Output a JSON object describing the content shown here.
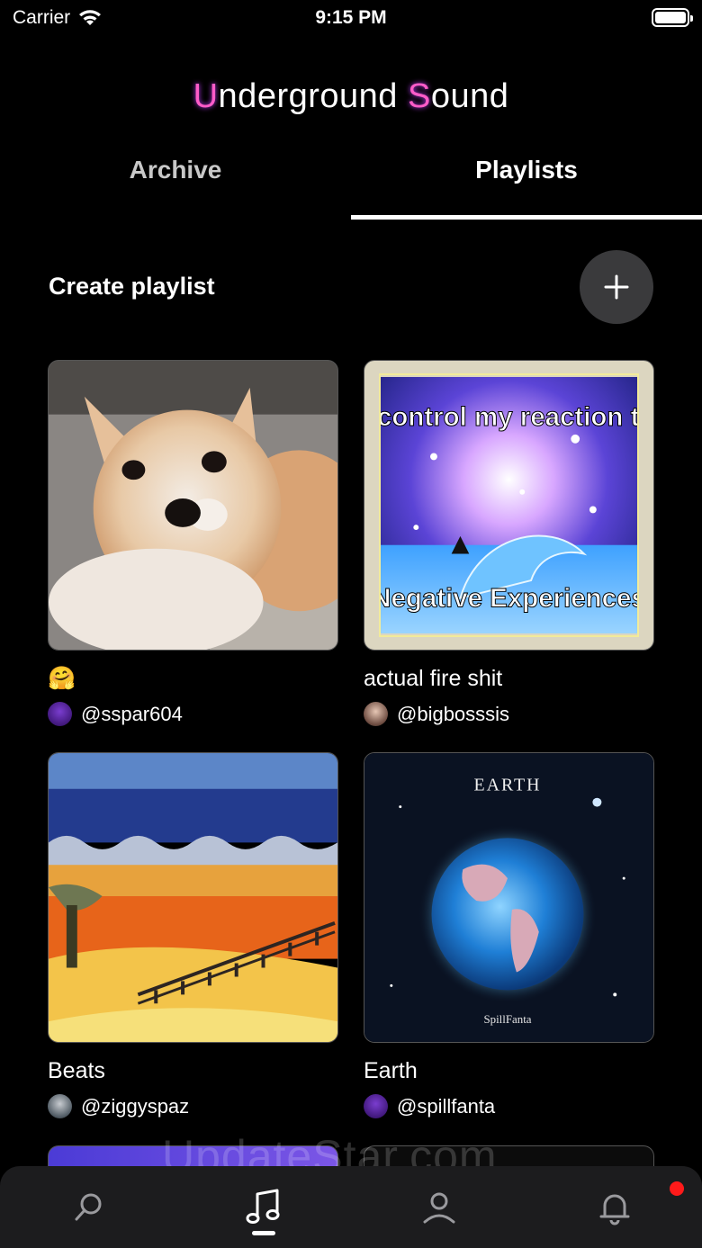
{
  "status": {
    "carrier": "Carrier",
    "time": "9:15 PM"
  },
  "app": {
    "title_u": "U",
    "title_mid": "nderground ",
    "title_s": "S",
    "title_end": "ound"
  },
  "tabs": {
    "archive": "Archive",
    "playlists": "Playlists",
    "active": "Playlists"
  },
  "create": {
    "label": "Create playlist",
    "button_icon": "plus-icon"
  },
  "playlists": [
    {
      "title": "🤗",
      "user": "@sspar604",
      "cover": "chihuahua-photo"
    },
    {
      "title": "actual fire shit",
      "user": "@bigbosssis",
      "cover": "dolphin-meme",
      "cover_text_top": "I control my reaction to",
      "cover_text_bottom": "Negative Experiences"
    },
    {
      "title": "Beats",
      "user": "@ziggyspaz",
      "cover": "painted-landscape"
    },
    {
      "title": "Earth",
      "user": "@spillfanta",
      "cover": "earth-art",
      "cover_text_top": "EARTH",
      "cover_text_bottom": "SpillFanta"
    }
  ],
  "tabbar": [
    {
      "name": "search",
      "icon": "search-icon"
    },
    {
      "name": "library",
      "icon": "music-note-icon",
      "active": true
    },
    {
      "name": "profile",
      "icon": "person-icon"
    },
    {
      "name": "notifications",
      "icon": "bell-icon",
      "badge": true
    }
  ],
  "watermark": "UpdateStar.com",
  "colors": {
    "accent": "#ff5cc8",
    "background": "#000000",
    "tabbar": "#1c1c1e",
    "badge": "#ff1a1a"
  }
}
